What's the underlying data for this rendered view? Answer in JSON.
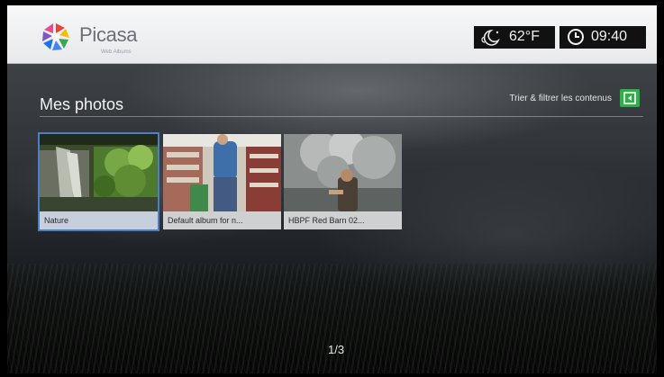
{
  "app": {
    "logo_text": "Picasa",
    "logo_subtext": "Web Albums"
  },
  "header": {
    "weather": {
      "icon": "moon-cloud-icon",
      "temperature": "62°F"
    },
    "clock": {
      "icon": "clock-icon",
      "time": "09:40"
    }
  },
  "main": {
    "title": "Mes photos",
    "sort_filter": {
      "label": "Trier & filtrer les contenus",
      "icon": "sort-filter-icon",
      "color": "#2fae4a"
    },
    "albums": [
      {
        "caption": "Nature",
        "selected": true
      },
      {
        "caption": "Default album for n...",
        "selected": false
      },
      {
        "caption": "HBPF Red Barn 02...",
        "selected": false
      }
    ],
    "page_indicator": "1/3"
  },
  "colors": {
    "selection": "#4d7ec9",
    "header_bg": "#eef0f2"
  }
}
